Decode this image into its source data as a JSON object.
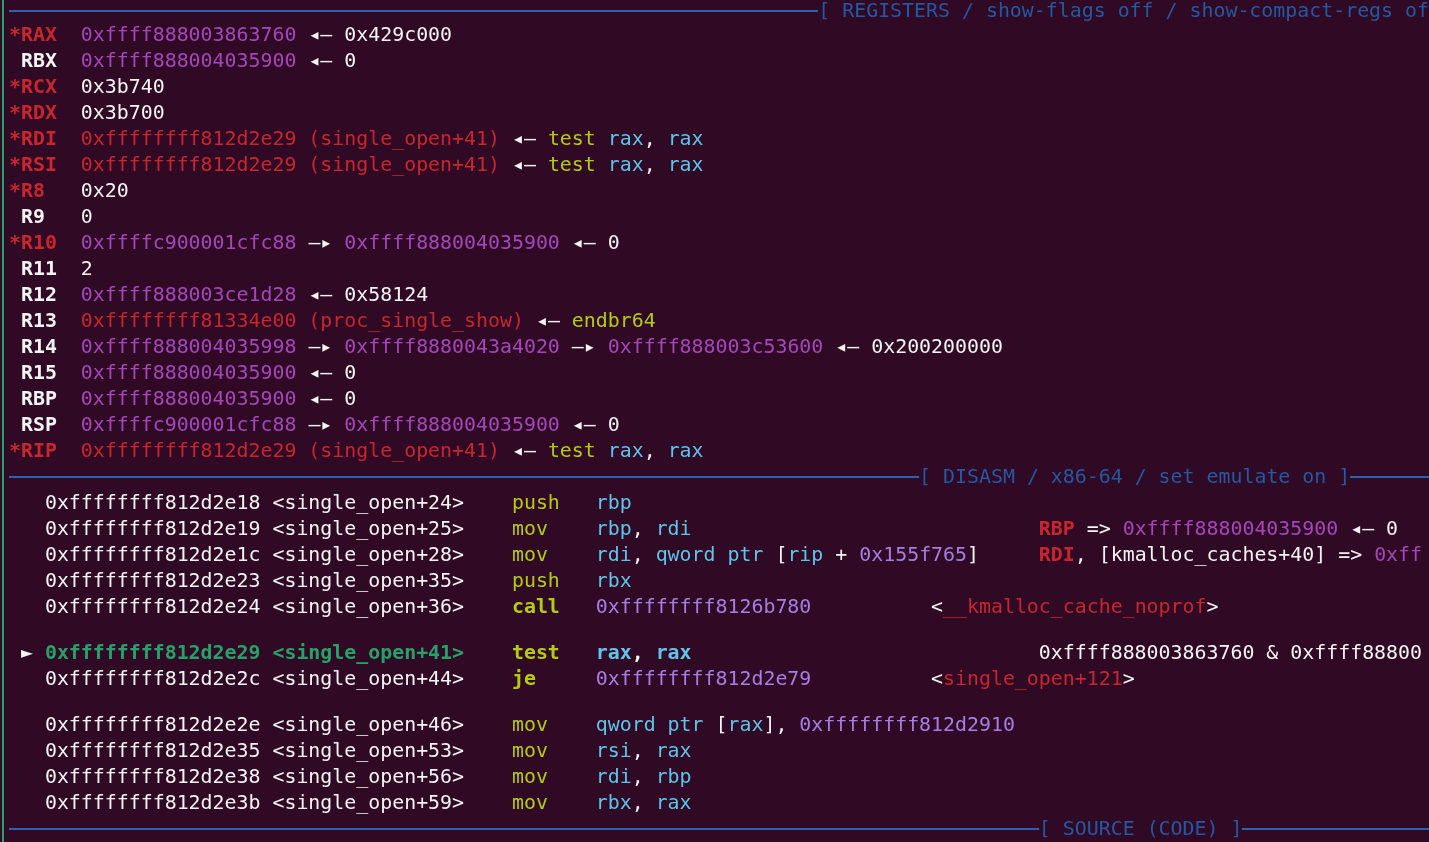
{
  "registers": {
    "title": "[ REGISTERS / show-flags off / show-compact-regs of",
    "rows": [
      {
        "name": "*RAX",
        "changed": true,
        "chain": [
          {
            "kind": "address",
            "text": "0xffff888003863760"
          },
          {
            "kind": "arrow",
            "text": "◂—"
          },
          {
            "kind": "value",
            "text": "0x429c000"
          }
        ]
      },
      {
        "name": "RBX",
        "changed": false,
        "chain": [
          {
            "kind": "address",
            "text": "0xffff888004035900"
          },
          {
            "kind": "arrow",
            "text": "◂—"
          },
          {
            "kind": "value",
            "text": "0"
          }
        ]
      },
      {
        "name": "*RCX",
        "changed": true,
        "chain": [
          {
            "kind": "value",
            "text": "0x3b740"
          }
        ]
      },
      {
        "name": "*RDX",
        "changed": true,
        "chain": [
          {
            "kind": "value",
            "text": "0x3b700"
          }
        ]
      },
      {
        "name": "*RDI",
        "changed": true,
        "chain": [
          {
            "kind": "code",
            "text": "0xffffffff812d2e29 (single_open+41)"
          },
          {
            "kind": "arrow",
            "text": "◂—"
          },
          {
            "kind": "instruction",
            "tokens": [
              {
                "kind": "mnemonic",
                "text": "test"
              },
              {
                "kind": "register",
                "text": " rax"
              },
              {
                "kind": "plain",
                "text": ", "
              },
              {
                "kind": "register",
                "text": "rax"
              }
            ]
          }
        ]
      },
      {
        "name": "*RSI",
        "changed": true,
        "chain": [
          {
            "kind": "code",
            "text": "0xffffffff812d2e29 (single_open+41)"
          },
          {
            "kind": "arrow",
            "text": "◂—"
          },
          {
            "kind": "instruction",
            "tokens": [
              {
                "kind": "mnemonic",
                "text": "test"
              },
              {
                "kind": "register",
                "text": " rax"
              },
              {
                "kind": "plain",
                "text": ", "
              },
              {
                "kind": "register",
                "text": "rax"
              }
            ]
          }
        ]
      },
      {
        "name": "*R8",
        "changed": true,
        "chain": [
          {
            "kind": "value",
            "text": "0x20"
          }
        ]
      },
      {
        "name": "R9",
        "changed": false,
        "chain": [
          {
            "kind": "value",
            "text": "0"
          }
        ]
      },
      {
        "name": "*R10",
        "changed": true,
        "chain": [
          {
            "kind": "address",
            "text": "0xffffc900001cfc88"
          },
          {
            "kind": "arrow",
            "text": "—▸"
          },
          {
            "kind": "address",
            "text": "0xffff888004035900"
          },
          {
            "kind": "arrow",
            "text": "◂—"
          },
          {
            "kind": "value",
            "text": "0"
          }
        ]
      },
      {
        "name": "R11",
        "changed": false,
        "chain": [
          {
            "kind": "value",
            "text": "2"
          }
        ]
      },
      {
        "name": "R12",
        "changed": false,
        "chain": [
          {
            "kind": "address",
            "text": "0xffff888003ce1d28"
          },
          {
            "kind": "arrow",
            "text": "◂—"
          },
          {
            "kind": "value",
            "text": "0x58124"
          }
        ]
      },
      {
        "name": "R13",
        "changed": false,
        "chain": [
          {
            "kind": "code",
            "text": "0xffffffff81334e00 (proc_single_show)"
          },
          {
            "kind": "arrow",
            "text": "◂—"
          },
          {
            "kind": "instruction",
            "tokens": [
              {
                "kind": "mnemonic",
                "text": "endbr64"
              }
            ]
          }
        ]
      },
      {
        "name": "R14",
        "changed": false,
        "chain": [
          {
            "kind": "address",
            "text": "0xffff888004035998"
          },
          {
            "kind": "arrow",
            "text": "—▸"
          },
          {
            "kind": "address",
            "text": "0xffff8880043a4020"
          },
          {
            "kind": "arrow",
            "text": "—▸"
          },
          {
            "kind": "address",
            "text": "0xffff888003c53600"
          },
          {
            "kind": "arrow",
            "text": "◂—"
          },
          {
            "kind": "value",
            "text": "0x200200000"
          }
        ]
      },
      {
        "name": "R15",
        "changed": false,
        "chain": [
          {
            "kind": "address",
            "text": "0xffff888004035900"
          },
          {
            "kind": "arrow",
            "text": "◂—"
          },
          {
            "kind": "value",
            "text": "0"
          }
        ]
      },
      {
        "name": "RBP",
        "changed": false,
        "chain": [
          {
            "kind": "address",
            "text": "0xffff888004035900"
          },
          {
            "kind": "arrow",
            "text": "◂—"
          },
          {
            "kind": "value",
            "text": "0"
          }
        ]
      },
      {
        "name": "RSP",
        "changed": false,
        "chain": [
          {
            "kind": "address",
            "text": "0xffffc900001cfc88"
          },
          {
            "kind": "arrow",
            "text": "—▸"
          },
          {
            "kind": "address",
            "text": "0xffff888004035900"
          },
          {
            "kind": "arrow",
            "text": "◂—"
          },
          {
            "kind": "value",
            "text": "0"
          }
        ]
      },
      {
        "name": "*RIP",
        "changed": true,
        "chain": [
          {
            "kind": "code",
            "text": "0xffffffff812d2e29 (single_open+41)"
          },
          {
            "kind": "arrow",
            "text": "◂—"
          },
          {
            "kind": "instruction",
            "tokens": [
              {
                "kind": "mnemonic",
                "text": "test"
              },
              {
                "kind": "register",
                "text": " rax"
              },
              {
                "kind": "plain",
                "text": ", "
              },
              {
                "kind": "register",
                "text": "rax"
              }
            ]
          }
        ]
      }
    ]
  },
  "disasm": {
    "title": "[ DISASM / x86-64 / set emulate on ]",
    "blocks": [
      [
        {
          "address": "0xffffffff812d2e18",
          "symbol": "<single_open+24>",
          "mnemonic": "push",
          "current": false,
          "operands": [
            {
              "kind": "register",
              "text": "rbp"
            }
          ]
        },
        {
          "address": "0xffffffff812d2e19",
          "symbol": "<single_open+25>",
          "mnemonic": "mov",
          "current": false,
          "operands": [
            {
              "kind": "register",
              "text": "rbp"
            },
            {
              "kind": "plain",
              "text": ", "
            },
            {
              "kind": "register",
              "text": "rdi"
            }
          ],
          "comment": {
            "kind": "emulation",
            "tokens": [
              {
                "kind": "reg-name",
                "text": "RBP"
              },
              {
                "kind": "plain",
                "text": " => "
              },
              {
                "kind": "address",
                "text": "0xffff888004035900"
              },
              {
                "kind": "plain",
                "text": " ◂— 0"
              }
            ]
          }
        },
        {
          "address": "0xffffffff812d2e1c",
          "symbol": "<single_open+28>",
          "mnemonic": "mov",
          "current": false,
          "operands": [
            {
              "kind": "register",
              "text": "rdi"
            },
            {
              "kind": "plain",
              "text": ", "
            },
            {
              "kind": "register",
              "text": "qword ptr"
            },
            {
              "kind": "plain",
              "text": " ["
            },
            {
              "kind": "register",
              "text": "rip"
            },
            {
              "kind": "plain",
              "text": " + "
            },
            {
              "kind": "immediate",
              "text": "0x155f765"
            },
            {
              "kind": "plain",
              "text": "]"
            }
          ],
          "comment": {
            "kind": "emulation",
            "tokens": [
              {
                "kind": "reg-name",
                "text": "RDI"
              },
              {
                "kind": "plain",
                "text": ", [kmalloc_caches+40] => "
              },
              {
                "kind": "address",
                "text": "0xff"
              }
            ]
          }
        },
        {
          "address": "0xffffffff812d2e23",
          "symbol": "<single_open+35>",
          "mnemonic": "push",
          "current": false,
          "operands": [
            {
              "kind": "register",
              "text": "rbx"
            }
          ]
        },
        {
          "address": "0xffffffff812d2e24",
          "symbol": "<single_open+36>",
          "mnemonic": "call",
          "current": false,
          "operands": [
            {
              "kind": "immediate",
              "text": "0xffffffff8126b780"
            }
          ],
          "comment": {
            "kind": "target",
            "tokens": [
              {
                "kind": "plain",
                "text": "<"
              },
              {
                "kind": "symbol",
                "text": "__kmalloc_cache_noprof"
              },
              {
                "kind": "plain",
                "text": ">"
              }
            ]
          }
        }
      ],
      [
        {
          "marker": "►",
          "address": "0xffffffff812d2e29",
          "symbol": "<single_open+41>",
          "mnemonic": "test",
          "current": true,
          "operands": [
            {
              "kind": "register",
              "text": "rax"
            },
            {
              "kind": "plain",
              "text": ", "
            },
            {
              "kind": "register",
              "text": "rax"
            }
          ],
          "comment": {
            "kind": "emulation",
            "tokens": [
              {
                "kind": "plain",
                "text": "0xffff888003863760 & 0xffff88800"
              }
            ]
          }
        },
        {
          "address": "0xffffffff812d2e2c",
          "symbol": "<single_open+44>",
          "mnemonic": "je",
          "current": false,
          "operands": [
            {
              "kind": "immediate",
              "text": "0xffffffff812d2e79"
            }
          ],
          "comment": {
            "kind": "target",
            "tokens": [
              {
                "kind": "plain",
                "text": "<"
              },
              {
                "kind": "symbol",
                "text": "single_open+121"
              },
              {
                "kind": "plain",
                "text": ">"
              }
            ]
          }
        }
      ],
      [
        {
          "address": "0xffffffff812d2e2e",
          "symbol": "<single_open+46>",
          "mnemonic": "mov",
          "current": false,
          "operands": [
            {
              "kind": "register",
              "text": "qword ptr"
            },
            {
              "kind": "plain",
              "text": " ["
            },
            {
              "kind": "register",
              "text": "rax"
            },
            {
              "kind": "plain",
              "text": "], "
            },
            {
              "kind": "immediate",
              "text": "0xffffffff812d2910"
            }
          ]
        },
        {
          "address": "0xffffffff812d2e35",
          "symbol": "<single_open+53>",
          "mnemonic": "mov",
          "current": false,
          "operands": [
            {
              "kind": "register",
              "text": "rsi"
            },
            {
              "kind": "plain",
              "text": ", "
            },
            {
              "kind": "register",
              "text": "rax"
            }
          ]
        },
        {
          "address": "0xffffffff812d2e38",
          "symbol": "<single_open+56>",
          "mnemonic": "mov",
          "current": false,
          "operands": [
            {
              "kind": "register",
              "text": "rdi"
            },
            {
              "kind": "plain",
              "text": ", "
            },
            {
              "kind": "register",
              "text": "rbp"
            }
          ]
        },
        {
          "address": "0xffffffff812d2e3b",
          "symbol": "<single_open+59>",
          "mnemonic": "mov",
          "current": false,
          "operands": [
            {
              "kind": "register",
              "text": "rbx"
            },
            {
              "kind": "plain",
              "text": ", "
            },
            {
              "kind": "register",
              "text": "rax"
            }
          ]
        }
      ]
    ]
  },
  "source": {
    "title": "[ SOURCE (CODE) ]"
  }
}
